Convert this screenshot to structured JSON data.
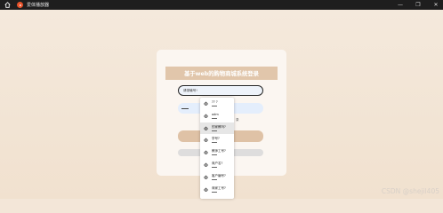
{
  "window": {
    "title": "爱体播放器",
    "controls": [
      "—",
      "❐",
      "✕"
    ]
  },
  "login": {
    "header": "基于web的购物商城系统登录",
    "username_value": "请录输号!",
    "password_mask": "",
    "side_text": "录"
  },
  "dropdown": {
    "items": [
      {
        "label": "?? ?"
      },
      {
        "label": "adm"
      },
      {
        "label": "的家教吗?",
        "active": true
      },
      {
        "label": "学号?"
      },
      {
        "label": "教师工号?"
      },
      {
        "label": "商户名?"
      },
      {
        "label": "客户编号?"
      },
      {
        "label": "商家工号?"
      }
    ]
  },
  "watermark": "CSDN @shejil405"
}
